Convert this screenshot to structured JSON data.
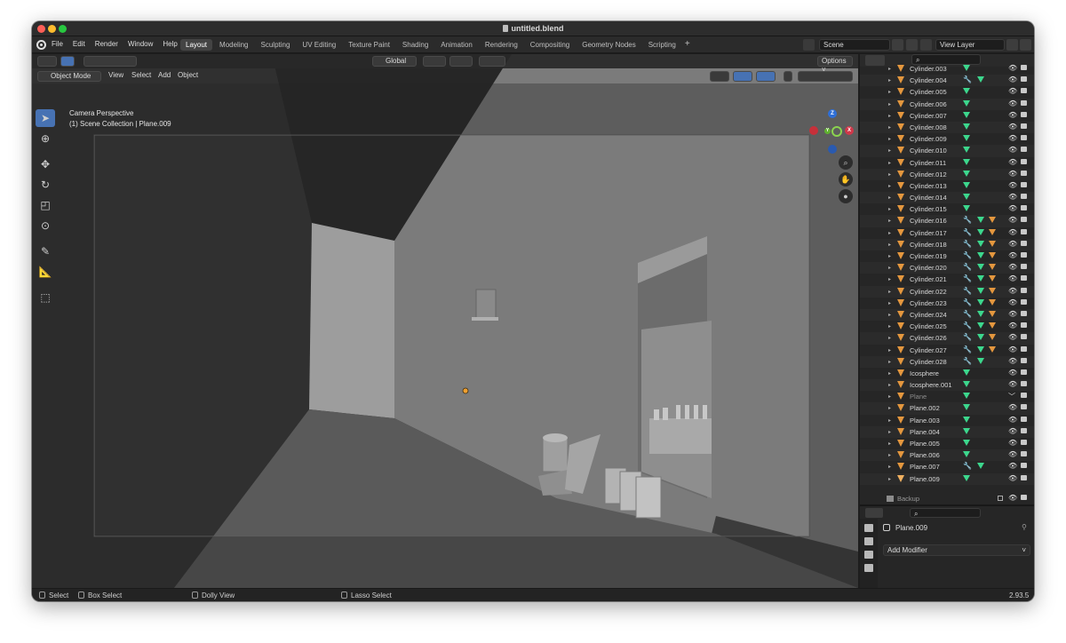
{
  "window": {
    "title": "untitled.blend"
  },
  "menu": [
    "File",
    "Edit",
    "Render",
    "Window",
    "Help"
  ],
  "workspaces": [
    "Layout",
    "Modeling",
    "Sculpting",
    "UV Editing",
    "Texture Paint",
    "Shading",
    "Animation",
    "Rendering",
    "Compositing",
    "Geometry Nodes",
    "Scripting"
  ],
  "active_workspace": "Layout",
  "scene": {
    "name": "Scene"
  },
  "view_layer": {
    "name": "View Layer"
  },
  "viewport": {
    "mode": "Object Mode",
    "menus": [
      "View",
      "Select",
      "Add",
      "Object"
    ],
    "transform_orientation": "Global",
    "options_label": "Options",
    "overlay_lines": [
      "Camera Perspective",
      "(1) Scene Collection | Plane.009"
    ],
    "gizmo": {
      "z": "Z",
      "y": "Y",
      "x": "X"
    }
  },
  "outliner": {
    "rows": [
      {
        "name": "Cylinder.003",
        "mod": false,
        "mat": false
      },
      {
        "name": "Cylinder.004",
        "mod": true,
        "mat": false
      },
      {
        "name": "Cylinder.005",
        "mod": false,
        "mat": false
      },
      {
        "name": "Cylinder.006",
        "mod": false,
        "mat": false
      },
      {
        "name": "Cylinder.007",
        "mod": false,
        "mat": false
      },
      {
        "name": "Cylinder.008",
        "mod": false,
        "mat": false
      },
      {
        "name": "Cylinder.009",
        "mod": false,
        "mat": false
      },
      {
        "name": "Cylinder.010",
        "mod": false,
        "mat": false
      },
      {
        "name": "Cylinder.011",
        "mod": false,
        "mat": false
      },
      {
        "name": "Cylinder.012",
        "mod": false,
        "mat": false
      },
      {
        "name": "Cylinder.013",
        "mod": false,
        "mat": false
      },
      {
        "name": "Cylinder.014",
        "mod": false,
        "mat": false
      },
      {
        "name": "Cylinder.015",
        "mod": false,
        "mat": false
      },
      {
        "name": "Cylinder.016",
        "mod": true,
        "mat": true
      },
      {
        "name": "Cylinder.017",
        "mod": true,
        "mat": true
      },
      {
        "name": "Cylinder.018",
        "mod": true,
        "mat": true
      },
      {
        "name": "Cylinder.019",
        "mod": true,
        "mat": true
      },
      {
        "name": "Cylinder.020",
        "mod": true,
        "mat": true
      },
      {
        "name": "Cylinder.021",
        "mod": true,
        "mat": true
      },
      {
        "name": "Cylinder.022",
        "mod": true,
        "mat": true
      },
      {
        "name": "Cylinder.023",
        "mod": true,
        "mat": true
      },
      {
        "name": "Cylinder.024",
        "mod": true,
        "mat": true
      },
      {
        "name": "Cylinder.025",
        "mod": true,
        "mat": true
      },
      {
        "name": "Cylinder.026",
        "mod": true,
        "mat": true
      },
      {
        "name": "Cylinder.027",
        "mod": true,
        "mat": true
      },
      {
        "name": "Cylinder.028",
        "mod": true,
        "mat": false
      },
      {
        "name": "Icosphere",
        "mod": false,
        "mat": false
      },
      {
        "name": "Icosphere.001",
        "mod": false,
        "mat": false
      },
      {
        "name": "Plane",
        "mod": false,
        "mat": false,
        "dim": true
      },
      {
        "name": "Plane.002",
        "mod": false,
        "mat": false
      },
      {
        "name": "Plane.003",
        "mod": false,
        "mat": false
      },
      {
        "name": "Plane.004",
        "mod": false,
        "mat": false
      },
      {
        "name": "Plane.005",
        "mod": false,
        "mat": false
      },
      {
        "name": "Plane.006",
        "mod": false,
        "mat": false
      },
      {
        "name": "Plane.007",
        "mod": true,
        "mat": false
      },
      {
        "name": "Plane.009",
        "mod": false,
        "mat": false,
        "selected": true
      }
    ],
    "collection": "Backup"
  },
  "properties": {
    "object_name": "Plane.009",
    "add_modifier_label": "Add Modifier"
  },
  "status": {
    "select": "Select",
    "box_select": "Box Select",
    "dolly_view": "Dolly View",
    "lasso_select": "Lasso Select",
    "version": "2.93.5"
  }
}
